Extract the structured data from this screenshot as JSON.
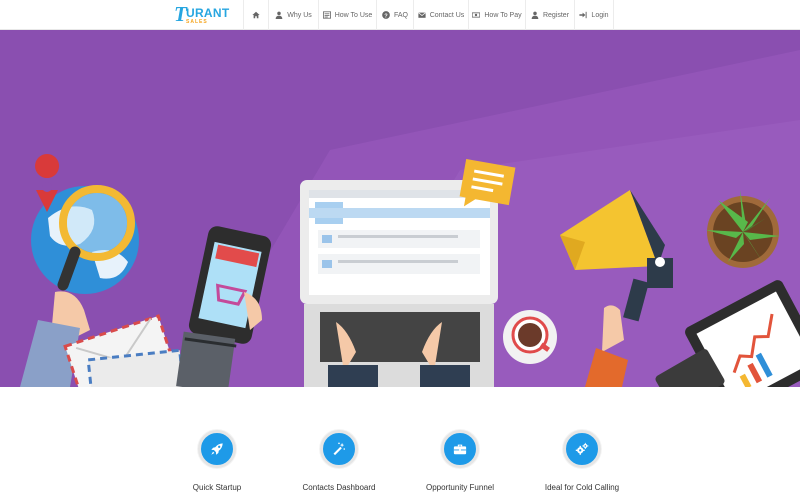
{
  "logo": {
    "initial": "T",
    "word": "URANT",
    "sub": "SALES"
  },
  "nav": [
    {
      "label": "",
      "icon": "home-icon"
    },
    {
      "label": "Why Us",
      "icon": "user-icon"
    },
    {
      "label": "How To Use",
      "icon": "list-icon"
    },
    {
      "label": "FAQ",
      "icon": "question-icon"
    },
    {
      "label": "Contact Us",
      "icon": "envelope-icon"
    },
    {
      "label": "How To Pay",
      "icon": "money-icon"
    },
    {
      "label": "Register",
      "icon": "user-icon"
    },
    {
      "label": "Login",
      "icon": "sign-in-icon"
    }
  ],
  "hero": {
    "background": "#8a4fb0",
    "accent": "#9a5bc0"
  },
  "features": [
    {
      "label": "Quick Startup",
      "icon": "rocket-icon"
    },
    {
      "label": "Contacts Dashboard",
      "icon": "magic-wand-icon"
    },
    {
      "label": "Opportunity Funnel",
      "icon": "briefcase-icon"
    },
    {
      "label": "Ideal for Cold Calling",
      "icon": "gears-icon"
    }
  ],
  "colors": {
    "brand": "#27a6e0",
    "feature_circle": "#1e9ae8"
  }
}
